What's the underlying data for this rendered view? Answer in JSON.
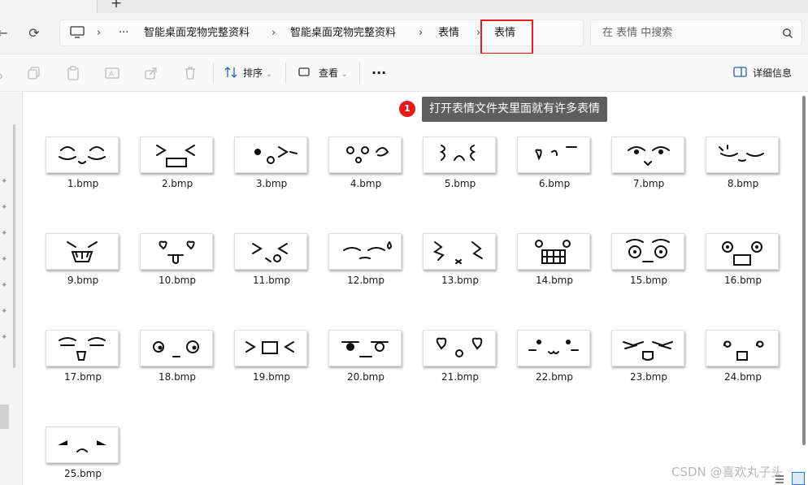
{
  "window": {
    "new_tab": "+"
  },
  "breadcrumb": {
    "more": "···",
    "items": [
      "智能桌面宠物完整资料",
      "智能桌面宠物完整资料",
      "表情",
      "表情"
    ],
    "separator": ">"
  },
  "search": {
    "placeholder": "在 表情 中搜索"
  },
  "toolbar": {
    "sort_label": "排序",
    "view_label": "查看",
    "more_label": "···",
    "details_label": "详细信息"
  },
  "annotation": {
    "badge": "1",
    "text": "打开表情文件夹里面就有许多表情",
    "highlight_color": "#e02020"
  },
  "files": [
    {
      "name": "1.bmp",
      "face": "smile-squint"
    },
    {
      "name": "2.bmp",
      "face": "cat-grin"
    },
    {
      "name": "3.bmp",
      "face": "wink-tongue"
    },
    {
      "name": "4.bmp",
      "face": "surprised-hand"
    },
    {
      "name": "5.bmp",
      "face": "dizzy-swirl"
    },
    {
      "name": "6.bmp",
      "face": "heart-eye"
    },
    {
      "name": "7.bmp",
      "face": "smug"
    },
    {
      "name": "8.bmp",
      "face": "sleepy"
    },
    {
      "name": "9.bmp",
      "face": "angry-fangs"
    },
    {
      "name": "10.bmp",
      "face": "heart-tongue"
    },
    {
      "name": "11.bmp",
      "face": "squint-lick"
    },
    {
      "name": "12.bmp",
      "face": "sweat-smile"
    },
    {
      "name": "13.bmp",
      "face": "rage-scribble"
    },
    {
      "name": "14.bmp",
      "face": "shock-teeth"
    },
    {
      "name": "15.bmp",
      "face": "wide-eyes"
    },
    {
      "name": "16.bmp",
      "face": "big-eyes-open"
    },
    {
      "name": "17.bmp",
      "face": "brow-laugh"
    },
    {
      "name": "18.bmp",
      "face": "side-eye"
    },
    {
      "name": "19.bmp",
      "face": "scream-arrows"
    },
    {
      "name": "20.bmp",
      "face": "annoyed"
    },
    {
      "name": "21.bmp",
      "face": "heart-kiss"
    },
    {
      "name": "22.bmp",
      "face": "shy-dots"
    },
    {
      "name": "23.bmp",
      "face": "cry-smile"
    },
    {
      "name": "24.bmp",
      "face": "spiral-eyes"
    },
    {
      "name": "25.bmp",
      "face": "sad-frown"
    }
  ],
  "watermark": "CSDN @喜欢丸子头",
  "icons": {
    "back": "refresh-icon",
    "pc": "monitor-icon",
    "search": "search-icon"
  }
}
